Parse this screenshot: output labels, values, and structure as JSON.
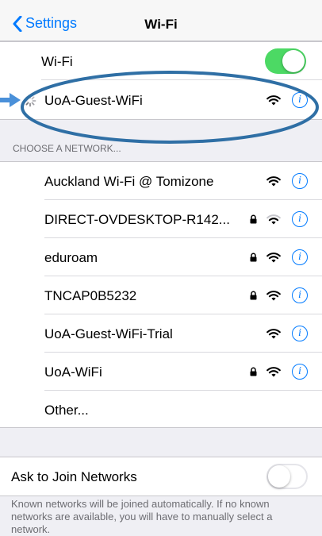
{
  "nav": {
    "back_label": "Settings",
    "title": "Wi-Fi"
  },
  "wifi_toggle": {
    "label": "Wi-Fi",
    "on": true
  },
  "current_network": {
    "name": "UoA-Guest-WiFi",
    "secured": false
  },
  "section_header": "CHOOSE A NETWORK...",
  "networks": [
    {
      "name": "Auckland Wi-Fi @ Tomizone",
      "secured": false
    },
    {
      "name": "DIRECT-OVDESKTOP-R142...",
      "secured": true
    },
    {
      "name": "eduroam",
      "secured": true
    },
    {
      "name": "TNCAP0B5232",
      "secured": true
    },
    {
      "name": "UoA-Guest-WiFi-Trial",
      "secured": false
    },
    {
      "name": "UoA-WiFi",
      "secured": true
    },
    {
      "name": "Other..."
    }
  ],
  "ask_to_join": {
    "label": "Ask to Join Networks",
    "on": false
  },
  "footer": "Known networks will be joined automatically. If no known networks are available, you will have to manually select a network.",
  "colors": {
    "accent": "#007aff",
    "toggle_on": "#4cd964",
    "annotation": "#2f6fa5"
  }
}
